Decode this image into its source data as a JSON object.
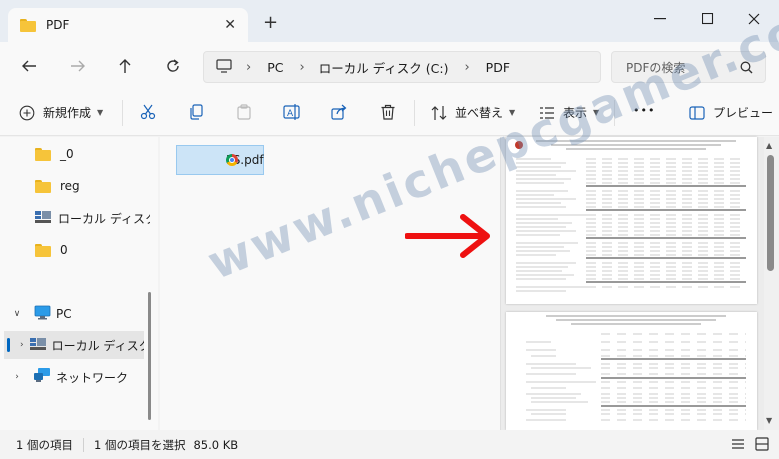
{
  "window": {
    "tab_title": "PDF",
    "tab_close": "✕",
    "new_tab": "+",
    "minimize": "—",
    "maximize": "☐",
    "close": "✕"
  },
  "nav": {
    "breadcrumbs": [
      "PC",
      "ローカル ディスク (C:)",
      "PDF"
    ],
    "search_placeholder": "PDFの検索"
  },
  "toolbar": {
    "new_label": "新規作成",
    "sort_label": "並べ替え",
    "view_label": "表示",
    "more_label": "•••",
    "preview_label": "プレビュー"
  },
  "sidebar": {
    "items": [
      {
        "label": "_0",
        "icon": "folder-icon"
      },
      {
        "label": "reg",
        "icon": "folder-icon"
      },
      {
        "label": "ローカル ディスク (C",
        "icon": "drive-icon"
      },
      {
        "label": "0",
        "icon": "folder-icon"
      },
      {
        "label": "PC",
        "icon": "pc-icon"
      },
      {
        "label": "ローカル ディスク",
        "icon": "drive-icon"
      },
      {
        "label": "ネットワーク",
        "icon": "network-icon"
      }
    ]
  },
  "files": [
    {
      "name": "FS.pdf",
      "icon": "chrome-pdf-icon",
      "selected": true
    }
  ],
  "status": {
    "item_count": "1 個の項目",
    "selected": "1 個の項目を選択",
    "size": "85.0 KB"
  },
  "watermark": "www.nichepcgamer.com",
  "colors": {
    "accent": "#0067c0",
    "selection_bg": "#cce4f7",
    "arrow": "#ee1111",
    "folder": "#f6c43a"
  }
}
